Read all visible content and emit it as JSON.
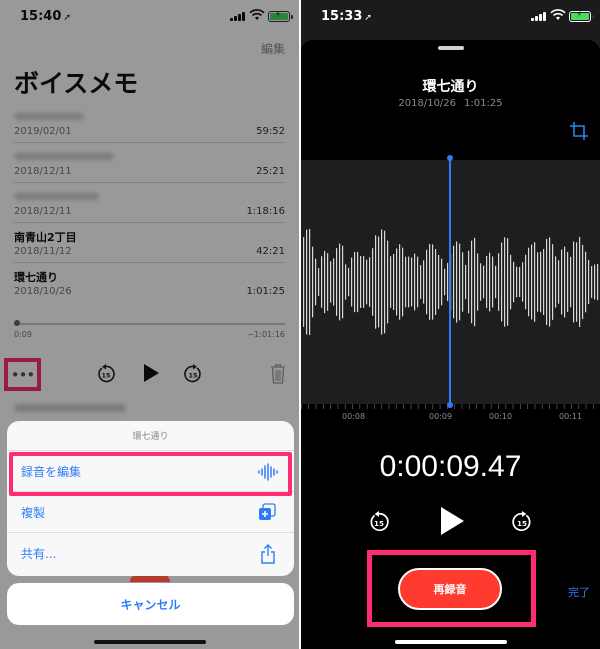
{
  "left_screen": {
    "status_bar": {
      "time": "15:40"
    },
    "header": {
      "edit_label": "編集",
      "title": "ボイスメモ"
    },
    "recordings": [
      {
        "name": "",
        "date": "2019/02/01",
        "duration": "59:52"
      },
      {
        "name": "",
        "date": "2018/12/11",
        "duration": "25:21"
      },
      {
        "name": "",
        "date": "2018/12/11",
        "duration": "1:18:16"
      },
      {
        "name": "南青山2丁目",
        "date": "2018/11/12",
        "duration": "42:21"
      },
      {
        "name": "環七通り",
        "date": "2018/10/26",
        "duration": "1:01:25"
      }
    ],
    "player": {
      "elapsed": "0:09",
      "remaining": "−1:01:16",
      "more_label": "•••"
    },
    "action_sheet": {
      "title": "環七通り",
      "items": [
        {
          "label": "録音を編集",
          "icon": "waveform-icon"
        },
        {
          "label": "複製",
          "icon": "duplicate-icon"
        },
        {
          "label": "共有...",
          "icon": "share-icon"
        }
      ],
      "cancel_label": "キャンセル"
    }
  },
  "right_screen": {
    "status_bar": {
      "time": "15:33"
    },
    "recording": {
      "title": "環七通り",
      "date": "2018/10/26",
      "duration": "1:01:25"
    },
    "timeline_labels": [
      "00:08",
      "00:09",
      "00:10",
      "00:11"
    ],
    "timer": "0:00:09.47",
    "rerecord_label": "再録音",
    "done_label": "完了",
    "skip_seconds": "15"
  },
  "colors": {
    "accent": "#2f7df6",
    "record_red": "#ff3b30",
    "highlight": "#ff2d6f"
  }
}
